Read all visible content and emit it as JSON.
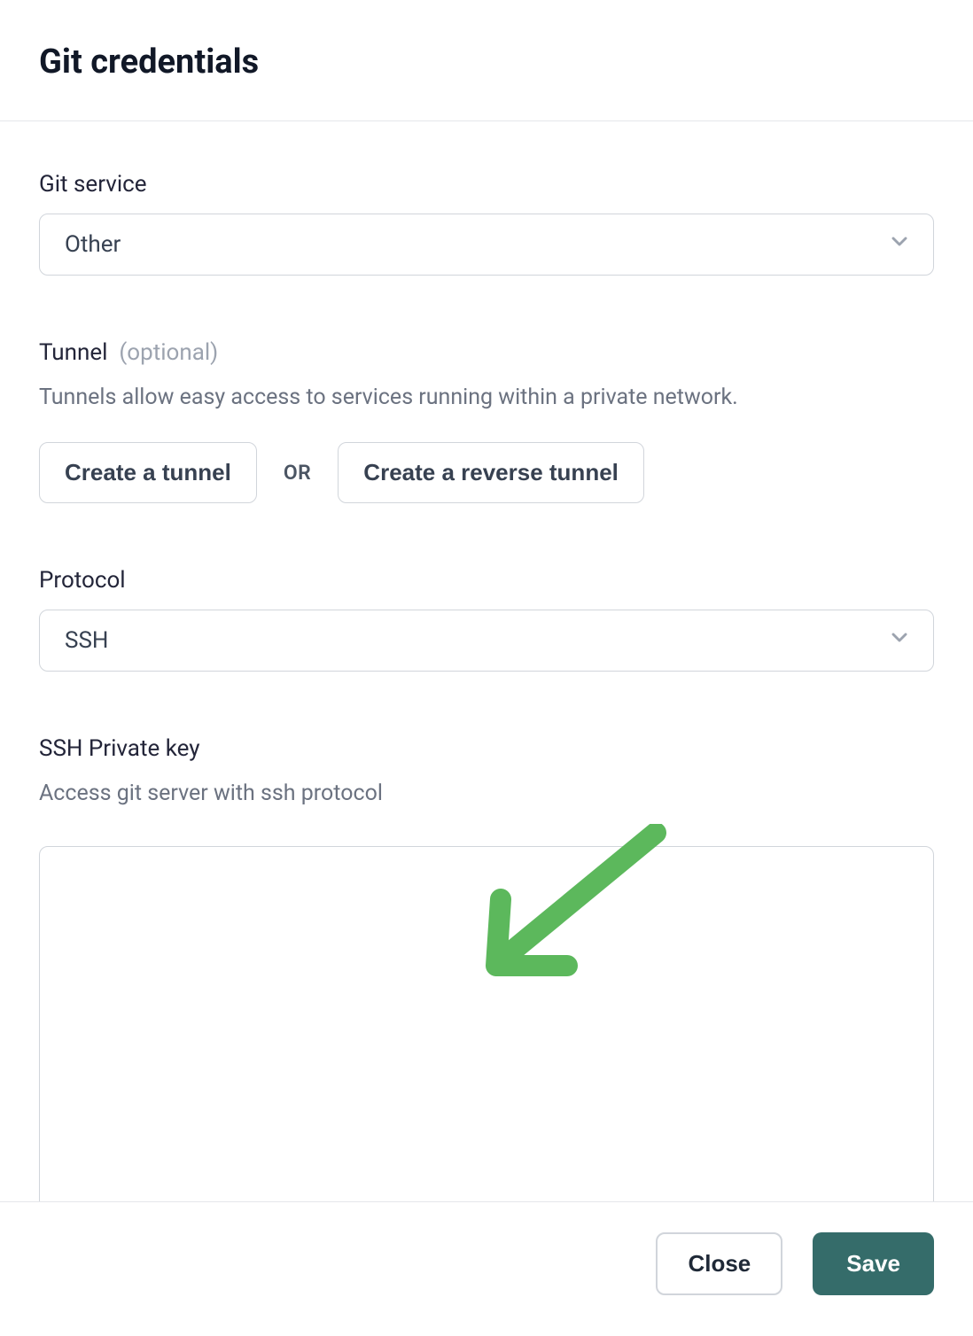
{
  "header": {
    "title": "Git credentials"
  },
  "git_service": {
    "label": "Git service",
    "selected": "Other"
  },
  "tunnel": {
    "label": "Tunnel",
    "optional_text": "(optional)",
    "description": "Tunnels allow easy access to services running within a private network.",
    "create_button": "Create a tunnel",
    "or_text": "OR",
    "create_reverse_button": "Create a reverse tunnel"
  },
  "protocol": {
    "label": "Protocol",
    "selected": "SSH"
  },
  "ssh_key": {
    "label": "SSH Private key",
    "description": "Access git server with ssh protocol",
    "value": ""
  },
  "footer": {
    "close_label": "Close",
    "save_label": "Save"
  },
  "annotation": {
    "arrow_color": "#5CB85C"
  }
}
